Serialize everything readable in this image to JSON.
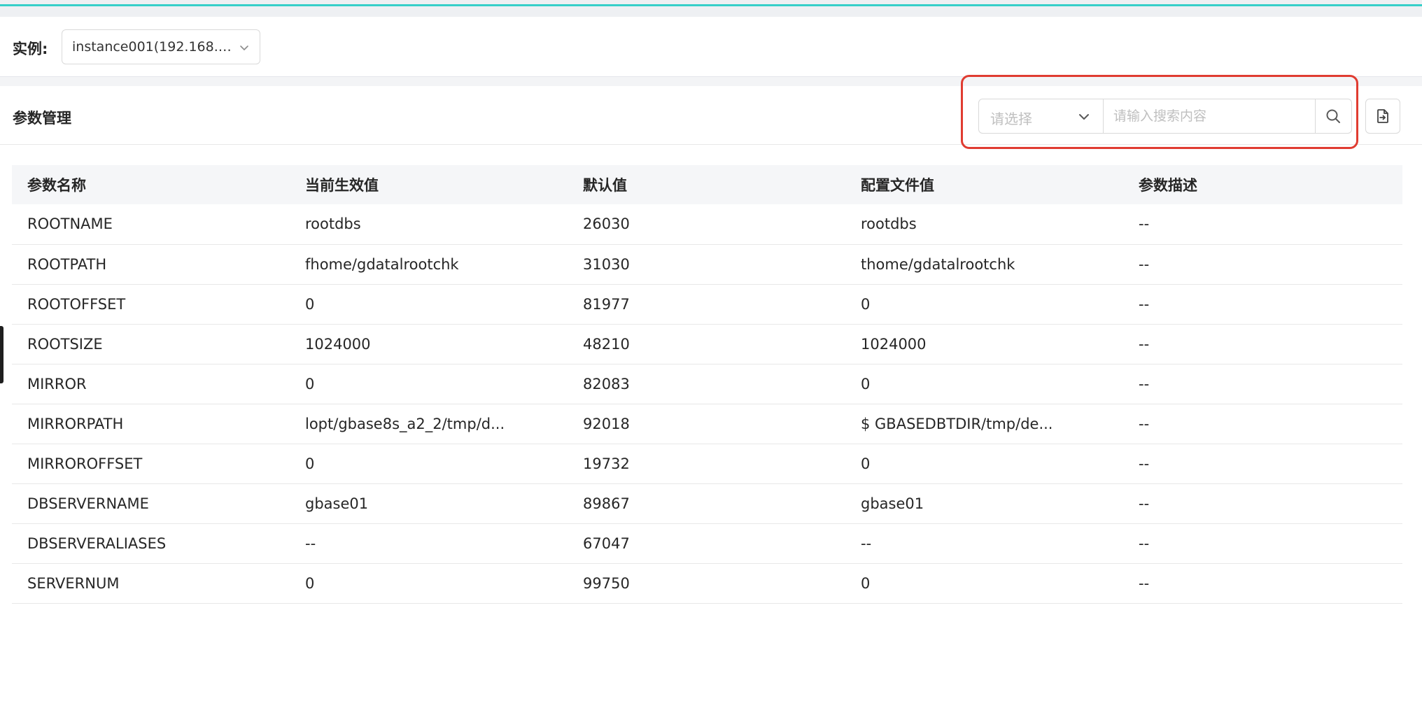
{
  "instance": {
    "label": "实例:",
    "selected": "instance001(192.168.…"
  },
  "header": {
    "title": "参数管理",
    "filter_placeholder": "请选择",
    "search_placeholder": "请输入搜索内容"
  },
  "colors": {
    "accent": "#36cfc9",
    "highlight": "#e03c31"
  },
  "table": {
    "columns": [
      "参数名称",
      "当前生效值",
      "默认值",
      "配置文件值",
      "参数描述"
    ],
    "rows": [
      [
        "ROOTNAME",
        "rootdbs",
        "26030",
        "rootdbs",
        "--"
      ],
      [
        "ROOTPATH",
        "fhome/gdatalrootchk",
        "31030",
        "thome/gdatalrootchk",
        "--"
      ],
      [
        "ROOTOFFSET",
        "0",
        "81977",
        "0",
        "--"
      ],
      [
        "ROOTSIZE",
        "1024000",
        "48210",
        "1024000",
        "--"
      ],
      [
        "MIRROR",
        "0",
        "82083",
        "0",
        "--"
      ],
      [
        "MIRRORPATH",
        "lopt/gbase8s_a2_2/tmp/d...",
        "92018",
        " $ GBASEDBTDIR/tmp/de...",
        "--"
      ],
      [
        "MIRROROFFSET",
        "0",
        "19732",
        "0",
        "--"
      ],
      [
        "DBSERVERNAME",
        "gbase01",
        "89867",
        "gbase01",
        "--"
      ],
      [
        "DBSERVERALIASES",
        "--",
        "67047",
        "--",
        "--"
      ],
      [
        "SERVERNUM",
        "0",
        "99750",
        "0",
        "--"
      ]
    ]
  }
}
